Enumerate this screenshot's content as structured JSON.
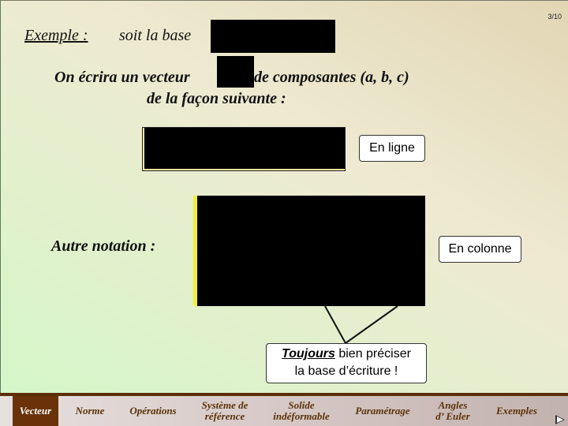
{
  "page": {
    "number": "3/10"
  },
  "content": {
    "example_label": "Exemple :",
    "example_text": "soit la base",
    "line1_before": "On écrira un vecteur",
    "line1_after": "de composantes (a, b, c)",
    "line2": "de la façon suivante :",
    "other_notation": "Autre notation :"
  },
  "callouts": {
    "row": "En ligne",
    "column": "En colonne",
    "note_emphasis": "Toujours",
    "note_rest_line1": " bien préciser",
    "note_line2": "la base d’écriture !"
  },
  "nav": {
    "items": [
      {
        "label": "Vecteur",
        "active": true
      },
      {
        "label": "Norme"
      },
      {
        "label": "Opérations"
      },
      {
        "label_line1": "Système de",
        "label_line2": "référence"
      },
      {
        "label_line1": "Solide",
        "label_line2": "indéformable"
      },
      {
        "label": "Paramétrage"
      },
      {
        "label_line1": "Angles",
        "label_line2": "d’ Euler"
      },
      {
        "label": "Exemples"
      }
    ],
    "next_icon": "next-slide-arrow-icon"
  }
}
